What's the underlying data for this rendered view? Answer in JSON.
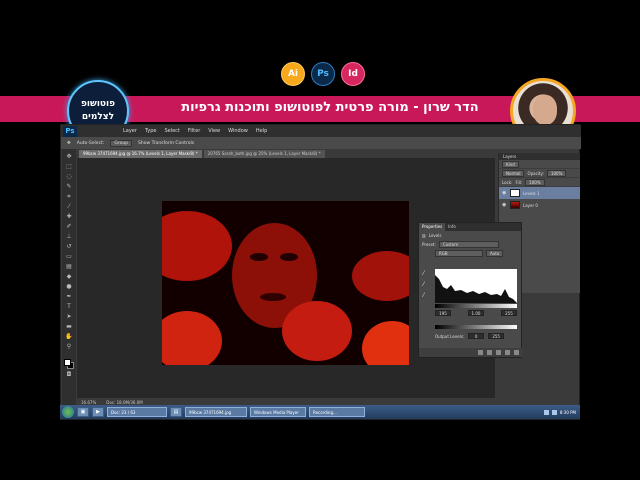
{
  "badges": [
    "Ai",
    "Ps",
    "Id"
  ],
  "banner": {
    "title": "הדר שרון - מורה פרטית לפוטושופ ותוכנות גרפיות",
    "logo_line1": "פוטושופ",
    "logo_line2": "לצלמים"
  },
  "colors": {
    "banner": "#c8185a",
    "accent_orange": "#f5a623",
    "ps_bg": "#3a3a3a"
  },
  "photoshop": {
    "app_icon": "Ps",
    "menu": [
      "Layer",
      "Type",
      "Select",
      "Filter",
      "View",
      "Window",
      "Help"
    ],
    "options_bar": {
      "auto_select": "Auto-Select:",
      "auto_select_value": "Group",
      "show_transform": "Show Transform Controls"
    },
    "tabs": [
      "99bcw 37471694.jpg @ 16.7% (Levels 1, Layer Mask/8) *",
      "20765 Sarah_both.jpg @ 25% (Levels 1, Layer Mask/8) *"
    ],
    "status": {
      "zoom": "16.67%",
      "doc": "Doc: 18.0M/36.0M"
    },
    "layers_panel": {
      "tab": "Layers",
      "kind": "Kind",
      "blend": "Normal",
      "opacity_label": "Opacity:",
      "opacity": "100%",
      "lock_label": "Lock:",
      "fill_label": "Fill:",
      "fill": "100%",
      "layers": [
        {
          "name": "Levels 1",
          "selected": true
        },
        {
          "name": "Layer 0",
          "selected": false
        }
      ]
    },
    "properties": {
      "tabs": [
        "Properties",
        "Info"
      ],
      "title": "Levels",
      "preset_label": "Preset:",
      "preset": "Custom",
      "channel": "RGB",
      "auto": "Auto",
      "input_values": [
        "195",
        "1.00",
        "255"
      ],
      "output_label": "Output Levels:",
      "output_values": [
        "0",
        "255"
      ]
    }
  },
  "taskbar": {
    "buttons": [
      "Doc: 23 / 63",
      "99bcw 37471694.jpg",
      "Windows Media Player",
      "Recording..."
    ],
    "clock": "8:30 PM"
  }
}
